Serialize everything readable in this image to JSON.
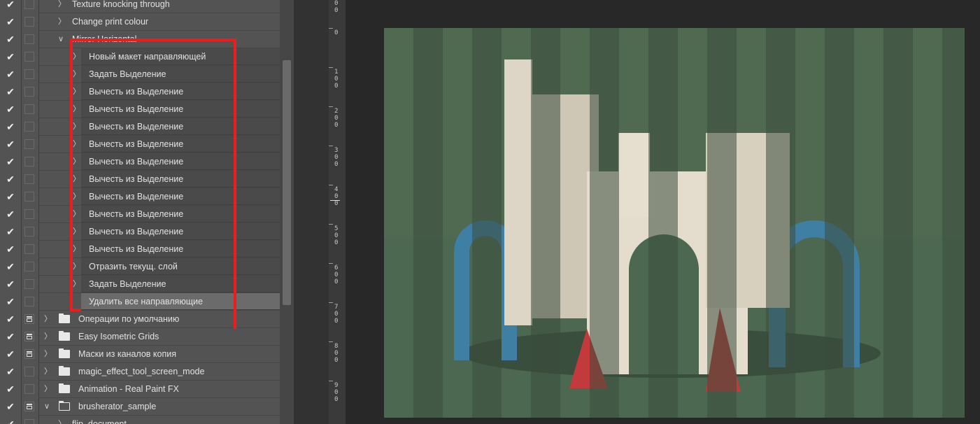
{
  "actions": {
    "items": [
      {
        "label": "Texture knocking through",
        "type": "action",
        "checked": true,
        "dialog": false,
        "expanded": false
      },
      {
        "label": "Change print colour",
        "type": "action",
        "checked": true,
        "dialog": false,
        "expanded": false
      },
      {
        "label": "Mirror Horizontal",
        "type": "action",
        "checked": true,
        "dialog": false,
        "expanded": true
      },
      {
        "label": "Новый макет направляющей",
        "type": "step",
        "checked": true,
        "dialog": false
      },
      {
        "label": "Задать Выделение",
        "type": "step",
        "checked": true,
        "dialog": false
      },
      {
        "label": "Вычесть из Выделение",
        "type": "step",
        "checked": true,
        "dialog": false
      },
      {
        "label": "Вычесть из Выделение",
        "type": "step",
        "checked": true,
        "dialog": false
      },
      {
        "label": "Вычесть из Выделение",
        "type": "step",
        "checked": true,
        "dialog": false
      },
      {
        "label": "Вычесть из Выделение",
        "type": "step",
        "checked": true,
        "dialog": false
      },
      {
        "label": "Вычесть из Выделение",
        "type": "step",
        "checked": true,
        "dialog": false
      },
      {
        "label": "Вычесть из Выделение",
        "type": "step",
        "checked": true,
        "dialog": false
      },
      {
        "label": "Вычесть из Выделение",
        "type": "step",
        "checked": true,
        "dialog": false
      },
      {
        "label": "Вычесть из Выделение",
        "type": "step",
        "checked": true,
        "dialog": false
      },
      {
        "label": "Вычесть из Выделение",
        "type": "step",
        "checked": true,
        "dialog": false
      },
      {
        "label": "Вычесть из Выделение",
        "type": "step",
        "checked": true,
        "dialog": false
      },
      {
        "label": "Отразить текущ. слой",
        "type": "step",
        "checked": true,
        "dialog": false
      },
      {
        "label": "Задать Выделение",
        "type": "step",
        "checked": true,
        "dialog": false
      },
      {
        "label": "Удалить все направляющие",
        "type": "step",
        "checked": true,
        "dialog": false,
        "selected": true,
        "noChevron": true
      },
      {
        "label": "Операции по умолчанию",
        "type": "set",
        "checked": true,
        "dialog": true,
        "expanded": false
      },
      {
        "label": "Easy Isometric Grids",
        "type": "set",
        "checked": true,
        "dialog": true,
        "expanded": false
      },
      {
        "label": "Маски из каналов копия",
        "type": "set",
        "checked": true,
        "dialog": true,
        "expanded": false
      },
      {
        "label": "magic_effect_tool_screen_mode",
        "type": "set",
        "checked": true,
        "dialog": false,
        "expanded": false
      },
      {
        "label": "Animation - Real Paint FX",
        "type": "set",
        "checked": true,
        "dialog": false,
        "expanded": false
      },
      {
        "label": "brusherator_sample",
        "type": "set",
        "checked": true,
        "dialog": true,
        "expanded": true
      },
      {
        "label": "flip_document",
        "type": "action",
        "checked": true,
        "dialog": false,
        "expanded": false
      }
    ]
  },
  "ruler": {
    "ticks": [
      {
        "digits": [
          "0"
        ]
      },
      {
        "digits": [
          "1",
          "0",
          "0"
        ]
      },
      {
        "digits": [
          "2",
          "0",
          "0"
        ]
      },
      {
        "digits": [
          "3",
          "0",
          "0"
        ]
      },
      {
        "digits": [
          "4",
          "0",
          "0"
        ]
      },
      {
        "digits": [
          "5",
          "0",
          "0"
        ]
      },
      {
        "digits": [
          "6",
          "0",
          "0"
        ]
      },
      {
        "digits": [
          "7",
          "0",
          "0"
        ]
      },
      {
        "digits": [
          "8",
          "0",
          "0"
        ]
      },
      {
        "digits": [
          "9",
          "0",
          "0"
        ]
      }
    ]
  },
  "colors": {
    "annotation": "#ee1c1c",
    "panel_bg": "#535353",
    "selected_row": "#6b6b6b",
    "canvas_bg": "#506a52",
    "stripe": "#3a4c3c"
  }
}
